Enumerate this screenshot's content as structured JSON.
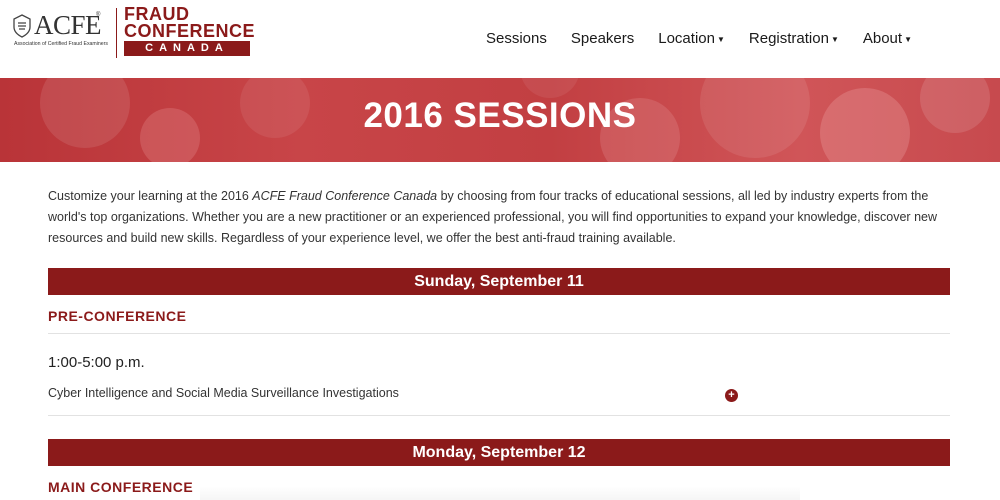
{
  "header": {
    "logo_acfe": "ACFE",
    "logo_tm": "®",
    "logo_acfe_sub": "Association of Certified Fraud Examiners",
    "logo_line1": "FRAUD",
    "logo_line2": "CONFERENCE",
    "logo_line3": "CANADA",
    "nav": [
      {
        "label": "Sessions",
        "dropdown": false
      },
      {
        "label": "Speakers",
        "dropdown": false
      },
      {
        "label": "Location",
        "dropdown": true
      },
      {
        "label": "Registration",
        "dropdown": true
      },
      {
        "label": "About",
        "dropdown": true
      }
    ]
  },
  "banner": {
    "title": "2016 SESSIONS"
  },
  "intro": {
    "before": "Customize your learning at the 2016 ",
    "emphasis": "ACFE Fraud Conference Canada",
    "after": " by choosing from four tracks of educational sessions, all led by industry experts from the world's top organizations. Whether you are a new practitioner or an experienced professional, you will find opportunities to expand your knowledge, discover new resources and build new skills. Regardless of your experience level, we offer the best anti-fraud training available."
  },
  "days": [
    {
      "title": "Sunday, September 11",
      "section": "PRE-CONFERENCE",
      "time": "1:00-5:00 p.m.",
      "session": "Cyber Intelligence and Social Media Surveillance Investigations",
      "expand_icon": "+"
    },
    {
      "title": "Monday, September 12",
      "section": "MAIN CONFERENCE"
    }
  ],
  "colors": {
    "brand": "#8b1a1a",
    "banner": "#c23f42"
  }
}
